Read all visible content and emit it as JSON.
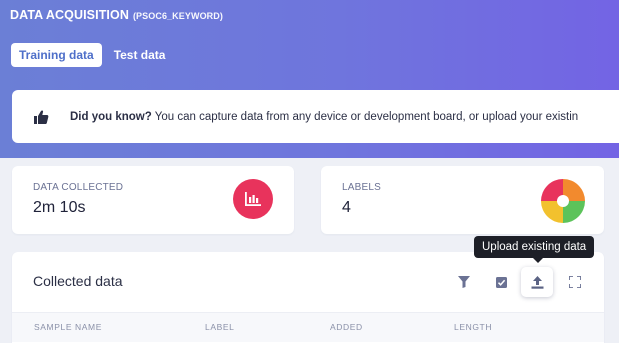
{
  "header": {
    "title": "DATA ACQUISITION",
    "subtitle": "(PSOC6_KEYWORD)"
  },
  "tabs": [
    {
      "label": "Training data",
      "active": true
    },
    {
      "label": "Test data",
      "active": false
    }
  ],
  "banner": {
    "icon": "thumbs-up-icon",
    "bold_text": "Did you know?",
    "text": "You can capture data from any device or development board, or upload your existin"
  },
  "stats": {
    "data_collected": {
      "label": "DATA COLLECTED",
      "value": "2m 10s",
      "icon": "bar-chart-icon",
      "color": "#e8335c"
    },
    "labels": {
      "label": "LABELS",
      "value": "4",
      "icon": "pie-chart-icon"
    }
  },
  "collected_data": {
    "title": "Collected data",
    "tooltip": "Upload existing data",
    "toolbar": [
      "filter-icon",
      "select-checkbox-icon",
      "upload-icon",
      "fullscreen-icon"
    ],
    "columns": [
      "SAMPLE NAME",
      "LABEL",
      "ADDED",
      "LENGTH"
    ]
  },
  "colors": {
    "hero_start": "#6b7fd6",
    "hero_end": "#7364e4",
    "accent_blue": "#4e6fc9",
    "pie": [
      "#e8335c",
      "#f28a2e",
      "#f2c12e",
      "#5cc35a"
    ]
  }
}
